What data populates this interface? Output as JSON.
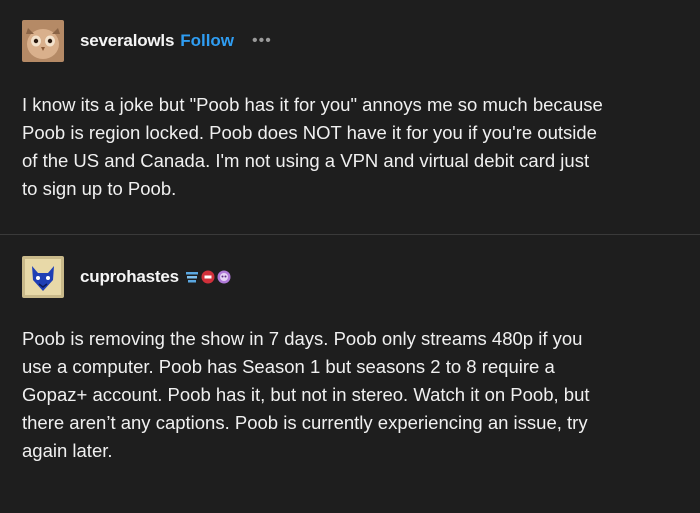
{
  "posts": [
    {
      "username": "severalowls",
      "follow_label": "Follow",
      "more_label": "•••",
      "avatar_icon": "owl-avatar-icon",
      "body": "I know its a joke but \"Poob has it for you\" annoys me so much because\nPoob is region locked. Poob does NOT have it for you if you're outside\nof the US and Canada. I'm not using a VPN and virtual debit card just\nto sign up to Poob."
    },
    {
      "username": "cuprohastes",
      "avatar_icon": "blue-fox-avatar-icon",
      "badges": [
        "stack-badge-icon",
        "red-shield-badge-icon",
        "purple-bot-badge-icon"
      ],
      "body": "Poob is removing the show in 7 days. Poob only streams 480p if you\nuse a computer. Poob has Season 1 but seasons 2 to 8 require a\nGopaz+ account. Poob has it, but not in stereo. Watch it on Poob, but\nthere aren’t any captions. Poob is currently experiencing an issue, try\nagain later."
    }
  ],
  "colors": {
    "background": "#1e1e1e",
    "text": "#f0f0f0",
    "follow": "#2f9df2",
    "divider": "#3a3a3a"
  }
}
